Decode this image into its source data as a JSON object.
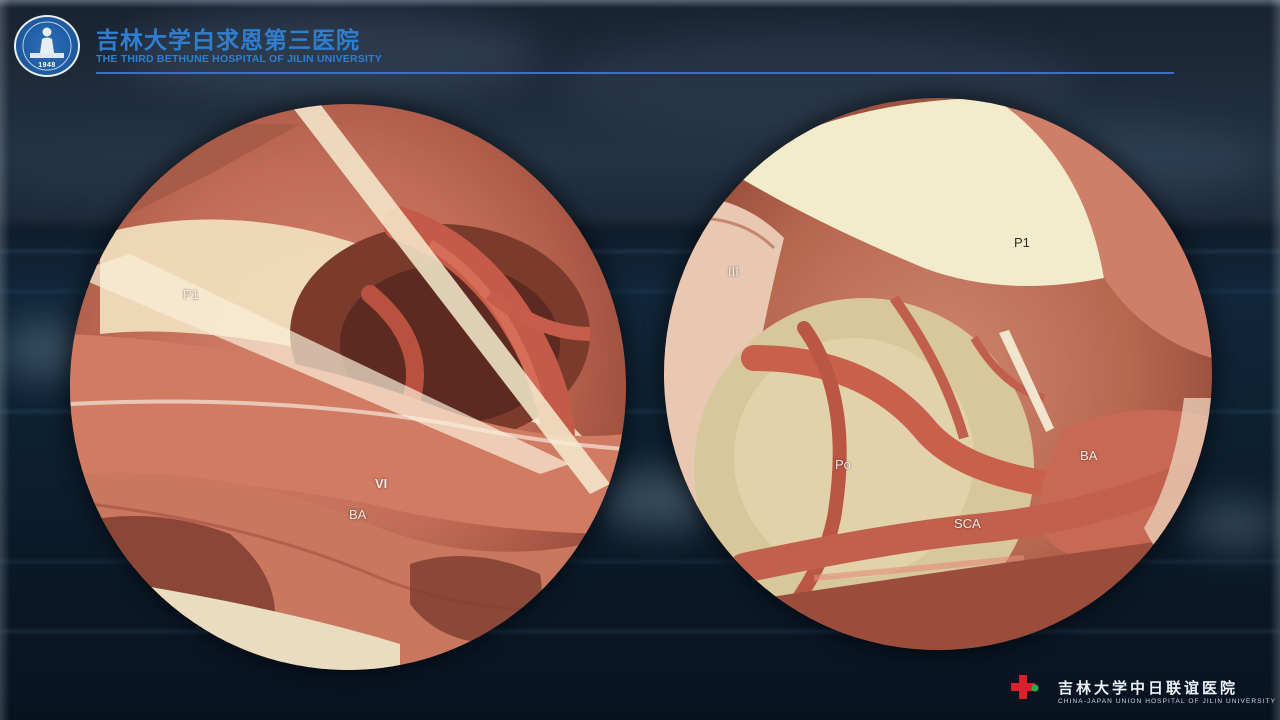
{
  "header": {
    "hospital_name_cn": "吉林大学白求恩第三医院",
    "hospital_name_en": "THE THIRD BETHUNE HOSPITAL OF JILIN UNIVERSITY",
    "logo_year": "1948",
    "accent_color": "#2f7fd1",
    "rule_color": "#3f6fc4"
  },
  "images": {
    "left": {
      "labels": {
        "p1": "P1",
        "vi": "VI",
        "ba": "BA"
      }
    },
    "right": {
      "labels": {
        "iii": "III",
        "p1": "P1",
        "po": "Po",
        "ba": "BA",
        "sca": "SCA"
      }
    }
  },
  "footer": {
    "union_name_cn": "吉林大学中日联谊医院",
    "union_name_en": "CHINA-JAPAN UNION HOSPITAL OF JILIN UNIVERSITY",
    "logo_cross_color": "#d8212a",
    "logo_dot_color": "#2fa84f"
  }
}
